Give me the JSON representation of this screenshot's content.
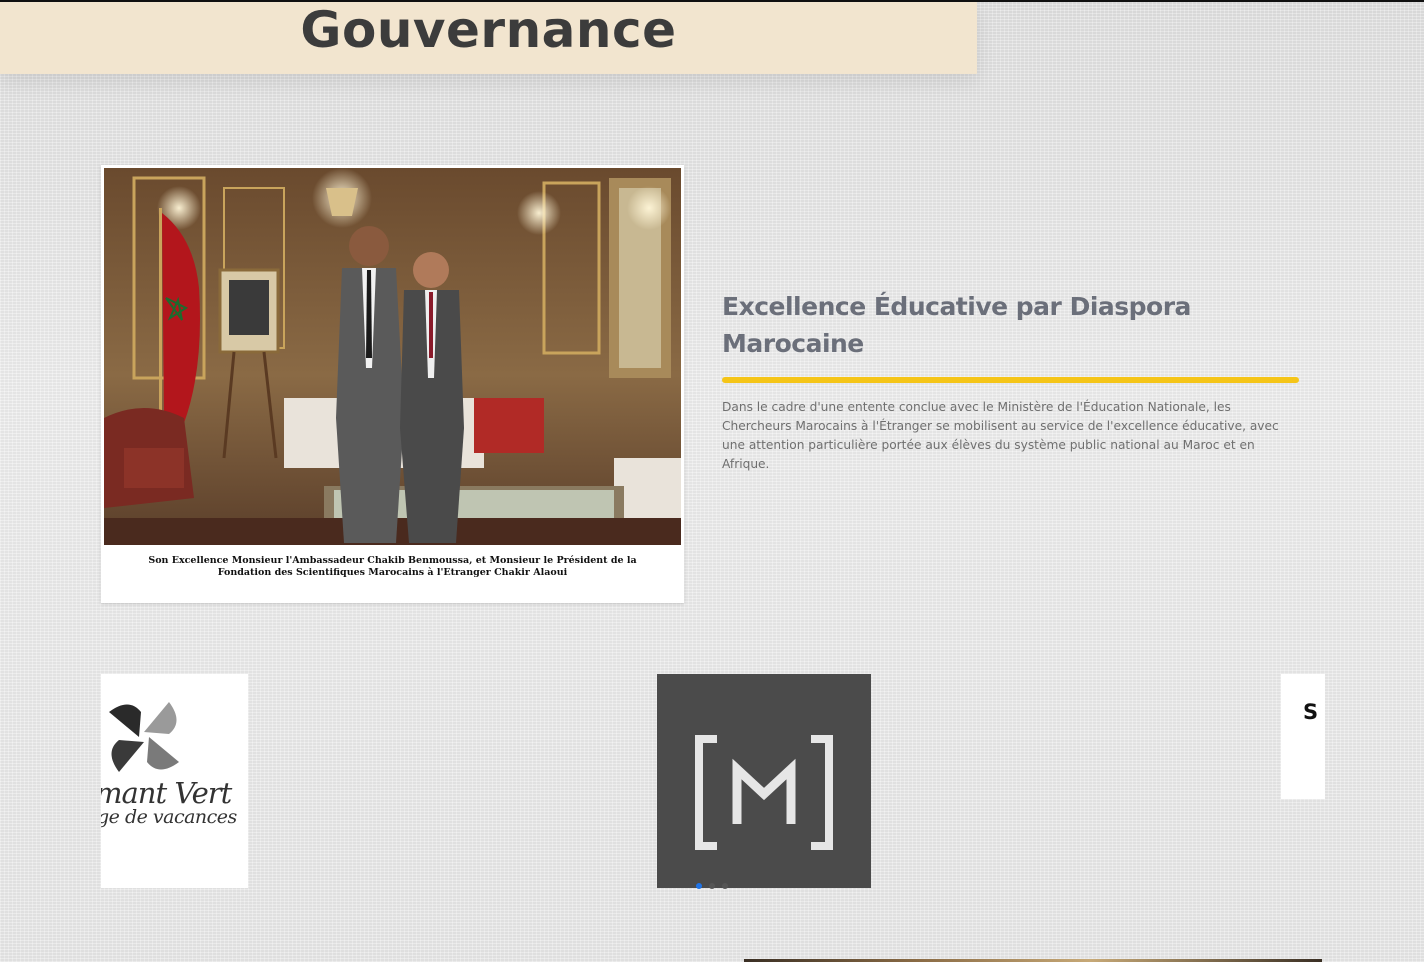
{
  "header": {
    "title": "Gouvernance"
  },
  "feature": {
    "photo_caption": "Son Excellence Monsieur l'Ambassadeur Chakib Benmoussa, et Monsieur le Président de la Fondation des Scientifiques Marocains à l'Etranger Chakir Alaoui",
    "heading": "Excellence Éducative par Diaspora Marocaine",
    "body": "Dans le cadre d'une entente conclue avec le Ministère de l'Éducation Nationale, les Chercheurs Marocains à l'Étranger se mobilisent au service de l'excellence éducative, avec une attention particulière portée aux élèves du système public national au Maroc et en Afrique.",
    "accent_color": "#f5c518"
  },
  "logos": {
    "left": {
      "line1": "mant Vert",
      "line2": "ge de vacances"
    },
    "middle": {
      "icon": "bracket-m-logo"
    },
    "right": {
      "text": "S"
    }
  },
  "carousel": {
    "dots": 3,
    "active_index": 0,
    "active_color": "#1e73e8"
  },
  "colors": {
    "title_bar": "#f2e5cf",
    "heading": "#6b6f7a"
  }
}
